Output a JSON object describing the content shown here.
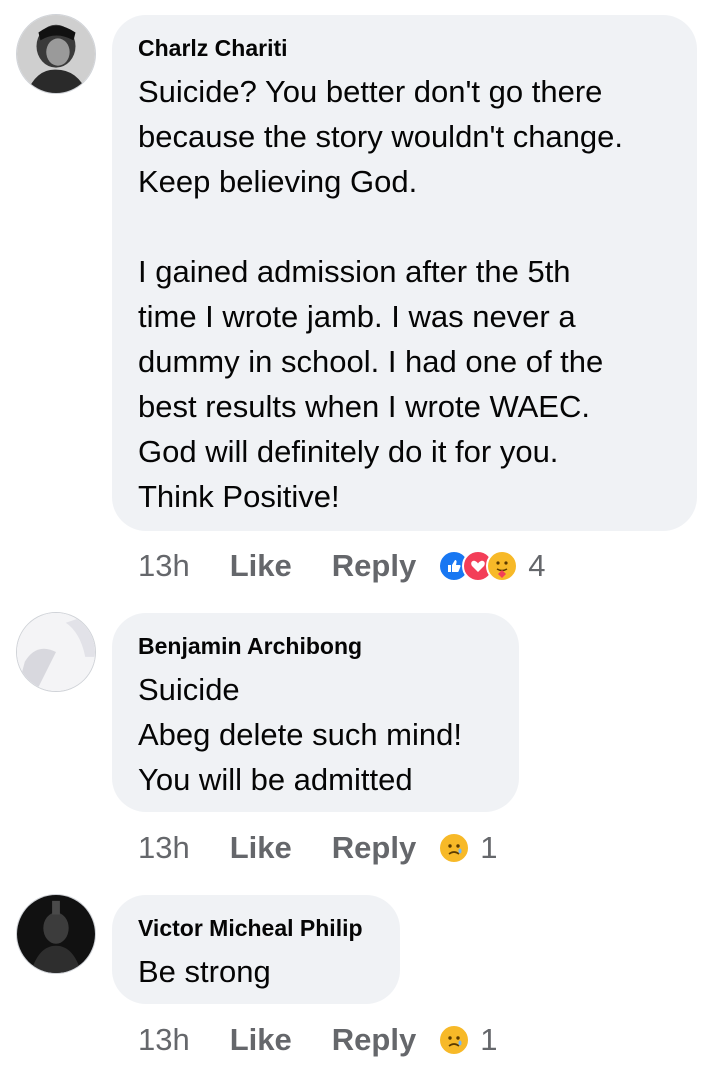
{
  "comments": [
    {
      "author": "Charlz Chariti",
      "lines": [
        "Suicide? You better don't go there",
        "because the story wouldn't change.",
        "Keep believing God.",
        "",
        "I gained admission after the 5th",
        "time I wrote jamb. I was never a",
        "dummy in school. I had one of the",
        "best results when I wrote WAEC.",
        "God will definitely do it for you.",
        "Think Positive!"
      ],
      "time": "13h",
      "like_label": "Like",
      "reply_label": "Reply",
      "reactions": [
        "like-reaction-icon",
        "love-reaction-icon",
        "care-reaction-icon"
      ],
      "reaction_count": "4"
    },
    {
      "author": "Benjamin Archibong",
      "lines": [
        "Suicide",
        "Abeg delete such mind!",
        "You will be admitted"
      ],
      "time": "13h",
      "like_label": "Like",
      "reply_label": "Reply",
      "reactions": [
        "sad-reaction-icon"
      ],
      "reaction_count": "1"
    },
    {
      "author": "Victor Micheal Philip",
      "lines": [
        "Be strong"
      ],
      "time": "13h",
      "like_label": "Like",
      "reply_label": "Reply",
      "reactions": [
        "sad-reaction-icon"
      ],
      "reaction_count": "1"
    }
  ],
  "colors": {
    "bubble": "#f0f2f5",
    "meta_text": "#65676b",
    "like_blue": "#1877f2",
    "love_red": "#f33e58",
    "emoji_yellow": "#f7b928"
  }
}
